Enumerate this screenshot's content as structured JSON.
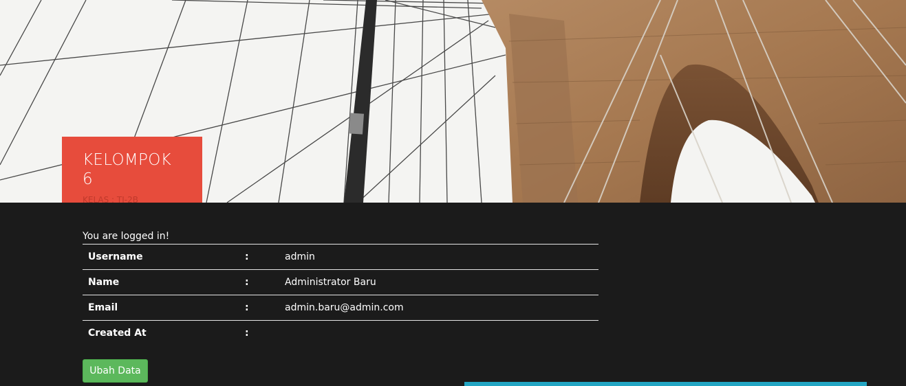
{
  "header": {
    "title": "KELOMPOK 6",
    "subtitle": "KELAS : TI-2B"
  },
  "profile": {
    "status": "You are logged in!",
    "rows": [
      {
        "label": "Username",
        "sep": ":",
        "value": "admin"
      },
      {
        "label": "Name",
        "sep": ":",
        "value": "Administrator Baru"
      },
      {
        "label": "Email",
        "sep": ":",
        "value": "admin.baru@admin.com"
      },
      {
        "label": "Created At",
        "sep": ":",
        "value": ""
      }
    ],
    "edit_button": "Ubah Data"
  },
  "colors": {
    "brand": "#e74c3c",
    "background": "#1b1b1b",
    "button": "#5cb85c",
    "accent": "#23a5c3"
  }
}
